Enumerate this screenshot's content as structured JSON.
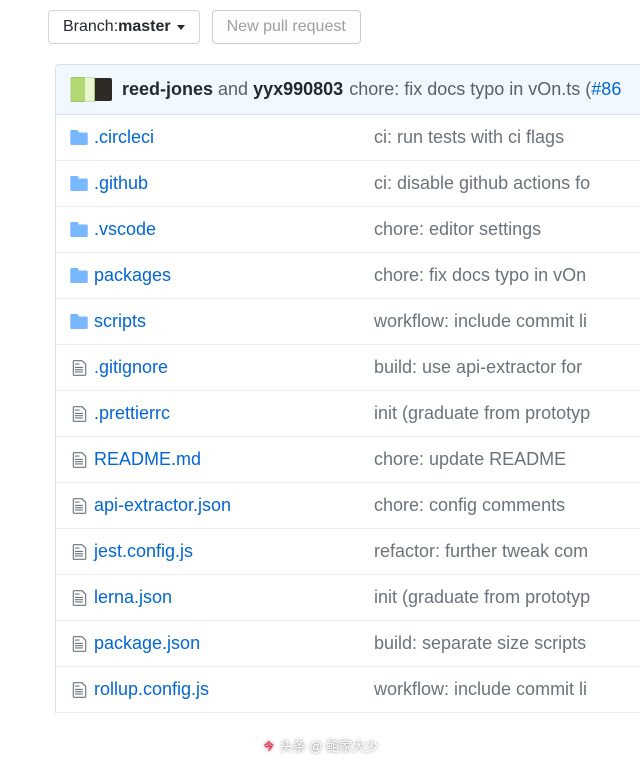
{
  "toolbar": {
    "branch_prefix": "Branch: ",
    "branch_name": "master",
    "new_pr": "New pull request"
  },
  "commit": {
    "author1": "reed-jones",
    "joiner": "and",
    "author2": "yyx990803",
    "message": "chore: fix docs typo in vOn.ts (",
    "pr": "#86"
  },
  "files": [
    {
      "type": "dir",
      "name": ".circleci",
      "msg": "ci: run tests with ci flags"
    },
    {
      "type": "dir",
      "name": ".github",
      "msg": "ci: disable github actions fo"
    },
    {
      "type": "dir",
      "name": ".vscode",
      "msg": "chore: editor settings"
    },
    {
      "type": "dir",
      "name": "packages",
      "msg": "chore: fix docs typo in vOn"
    },
    {
      "type": "dir",
      "name": "scripts",
      "msg": "workflow: include commit li"
    },
    {
      "type": "file",
      "name": ".gitignore",
      "msg": "build: use api-extractor for"
    },
    {
      "type": "file",
      "name": ".prettierrc",
      "msg": "init (graduate from prototyp"
    },
    {
      "type": "file",
      "name": "README.md",
      "msg": "chore: update README"
    },
    {
      "type": "file",
      "name": "api-extractor.json",
      "msg": "chore: config comments"
    },
    {
      "type": "file",
      "name": "jest.config.js",
      "msg": "refactor: further tweak com"
    },
    {
      "type": "file",
      "name": "lerna.json",
      "msg": "init (graduate from prototyp"
    },
    {
      "type": "file",
      "name": "package.json",
      "msg": "build: separate size scripts"
    },
    {
      "type": "file",
      "name": "rollup.config.js",
      "msg": "workflow: include commit li"
    }
  ],
  "watermark": "头条 @ 鲍家大少"
}
